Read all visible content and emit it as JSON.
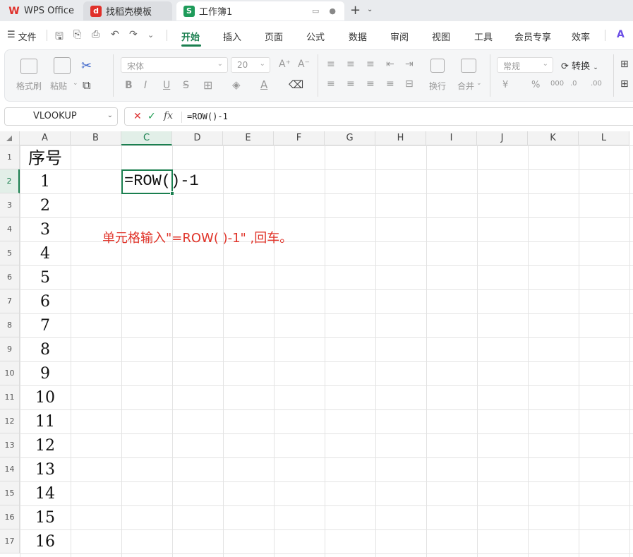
{
  "tabs": [
    {
      "id": "tab-wps",
      "label": "WPS Office",
      "icon": "wps-logo-icon"
    },
    {
      "id": "tab-dk",
      "label": "找稻壳模板",
      "icon": "docer-icon"
    },
    {
      "id": "tab-wb",
      "label": "工作簿1",
      "icon": "spreadsheet-icon",
      "badge": "S"
    }
  ],
  "menubar": {
    "file": "文件",
    "items": [
      "开始",
      "插入",
      "页面",
      "公式",
      "数据",
      "审阅",
      "视图",
      "工具",
      "会员专享",
      "效率"
    ],
    "active": "开始"
  },
  "ribbon": {
    "format_painter": "格式刷",
    "paste": "粘贴",
    "font_name": "宋体",
    "font_size": "20",
    "wrap": "换行",
    "merge": "合并",
    "number_format": "常规",
    "convert": "转换"
  },
  "formula_bar": {
    "name_box": "VLOOKUP",
    "fx": "fx",
    "formula": "=ROW()-1"
  },
  "columns": [
    "A",
    "B",
    "C",
    "D",
    "E",
    "F",
    "G",
    "H",
    "I",
    "J",
    "K",
    "L"
  ],
  "selected_column": "C",
  "rows": [
    "1",
    "2",
    "3",
    "4",
    "5",
    "6",
    "7",
    "8",
    "9",
    "10",
    "11",
    "12",
    "13",
    "14",
    "15",
    "16",
    "17"
  ],
  "selected_row": "2",
  "column_a": {
    "header": "序号",
    "values": [
      "1",
      "2",
      "3",
      "4",
      "5",
      "6",
      "7",
      "8",
      "9",
      "10",
      "11",
      "12",
      "13",
      "14",
      "15",
      "16"
    ]
  },
  "active_cell_content": "=ROW()-1",
  "instruction": "单元格输入\"=ROW( )-1\" ,回车。"
}
